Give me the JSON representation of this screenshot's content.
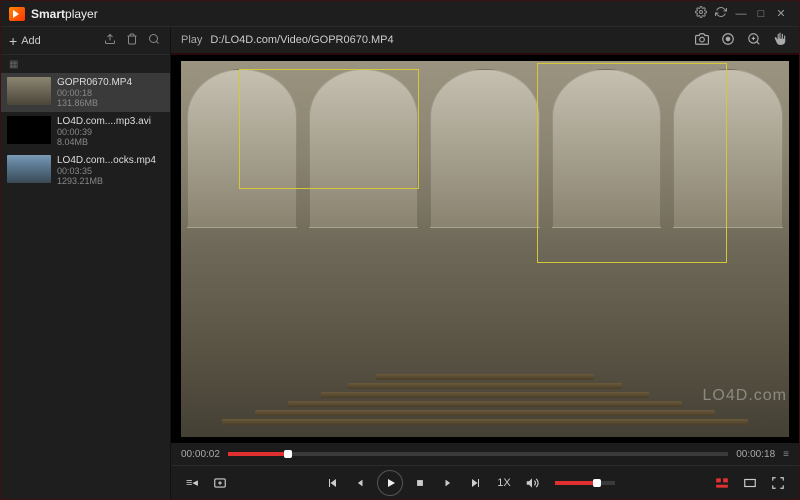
{
  "app": {
    "name_bold": "Smart",
    "name_rest": "player"
  },
  "title_icons": {
    "gear": "gear-icon",
    "refresh": "refresh-icon",
    "min": "minimize-icon",
    "max": "maximize-icon",
    "close": "close-icon"
  },
  "sidebar": {
    "add_label": "Add",
    "items": [
      {
        "name": "GOPR0670.MP4",
        "duration": "00:00:18",
        "size": "131.86MB",
        "selected": true,
        "thumb": "cathedral"
      },
      {
        "name": "LO4D.com....mp3.avi",
        "duration": "00:00:39",
        "size": "8.04MB",
        "selected": false,
        "thumb": "black"
      },
      {
        "name": "LO4D.com...ocks.mp4",
        "duration": "00:03:35",
        "size": "1293.21MB",
        "selected": false,
        "thumb": "rocks"
      }
    ]
  },
  "video": {
    "play_label": "Play",
    "path": "D:/LO4D.com/Video/GOPR0670.MP4"
  },
  "progress": {
    "current": "00:00:02",
    "total": "00:00:18",
    "percent": 12
  },
  "controls": {
    "speed": "1X",
    "volume_percent": 70
  },
  "watermark": "LO4D.com",
  "colors": {
    "accent": "#e03030",
    "highlight": "#d4c838"
  }
}
